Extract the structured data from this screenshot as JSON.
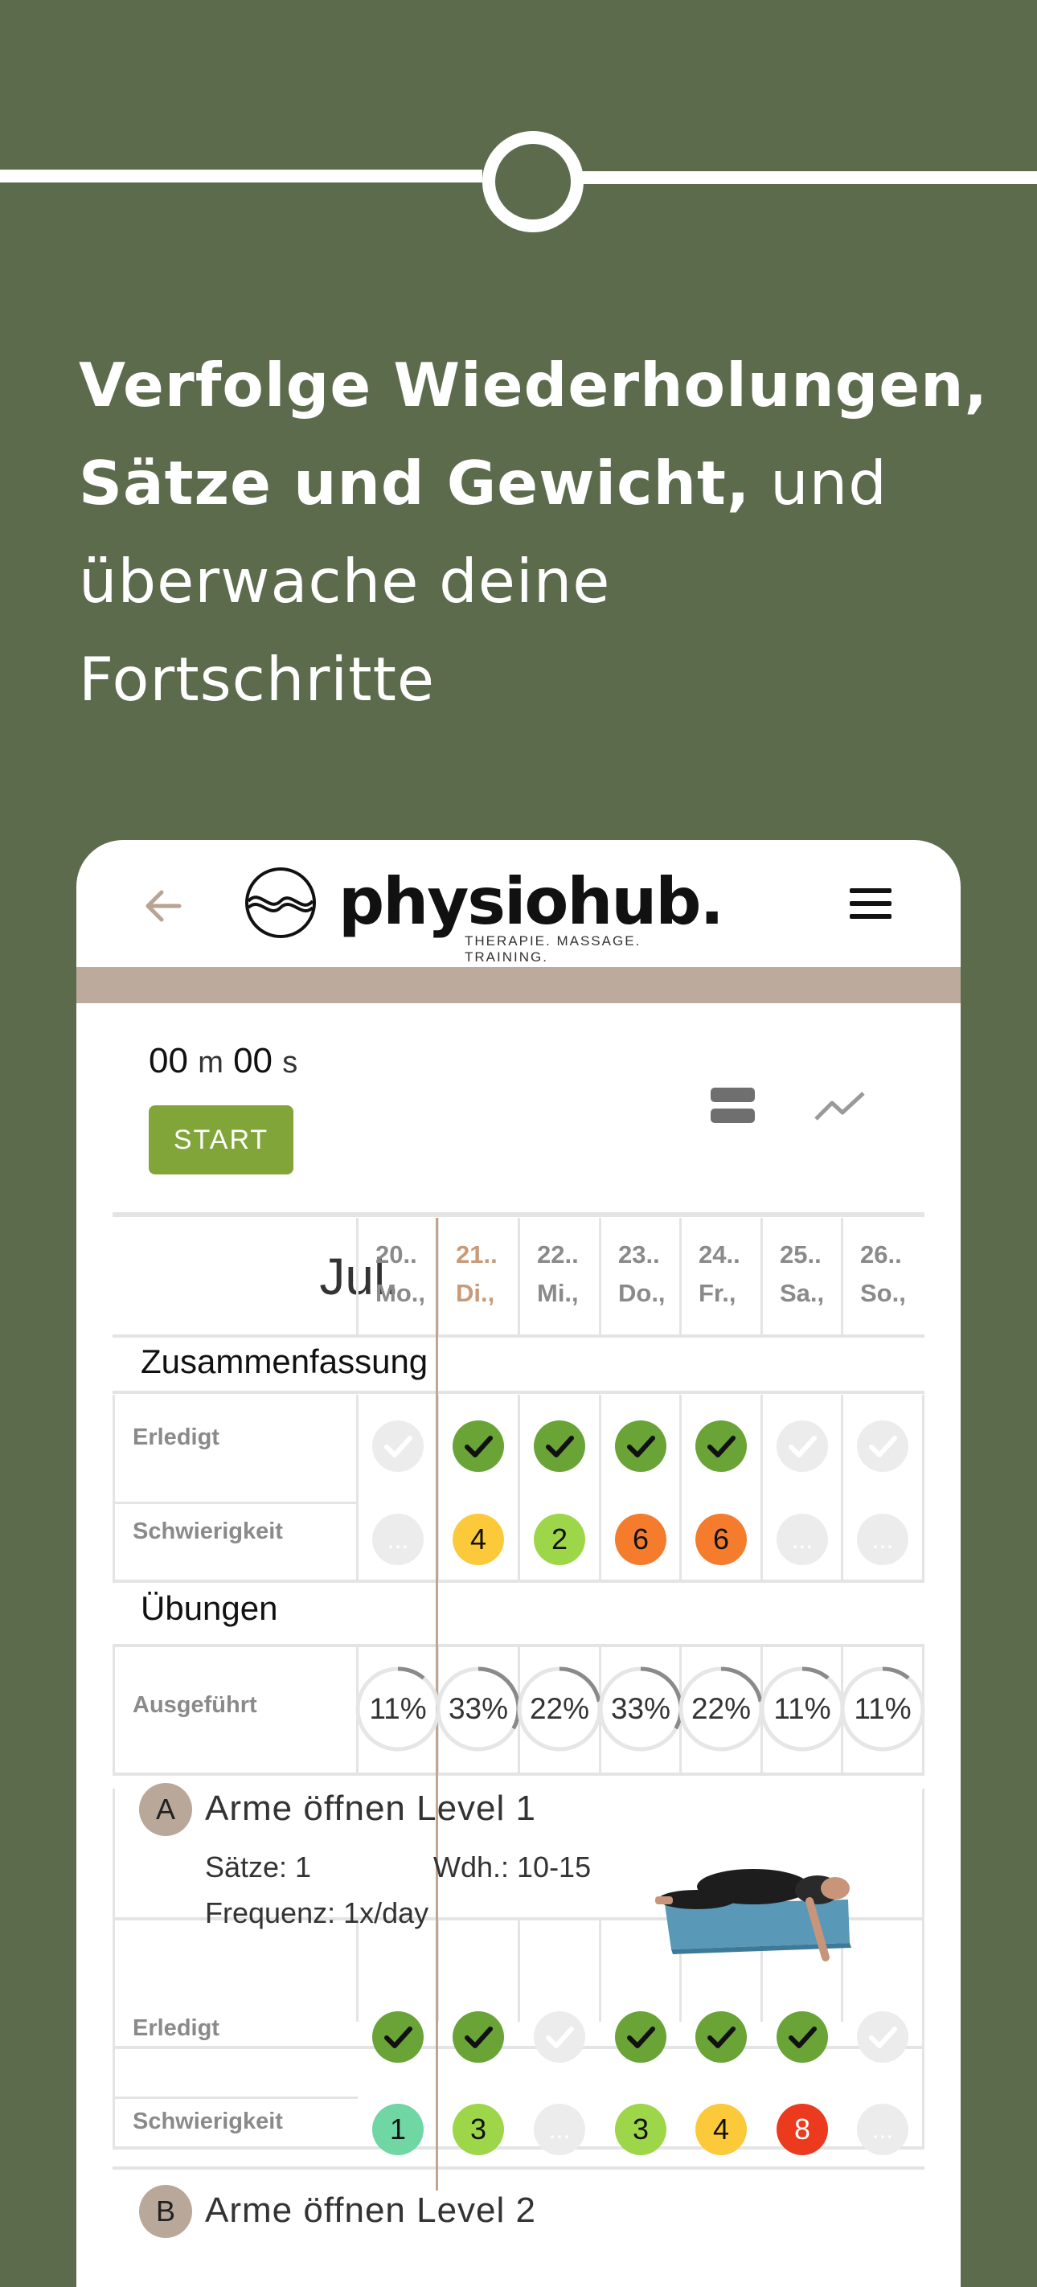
{
  "headline": {
    "bold1": "Verfolge Wiederholungen,",
    "bold2": "Sätze und Gewicht,",
    "normal2": " und",
    "line3": "überwache deine",
    "line4": "Fortschritte"
  },
  "app": {
    "logo_text": "physiohub.",
    "logo_tagline": "THERAPIE. MASSAGE. TRAINING.",
    "colors": {
      "accent": "#82a53a",
      "tan": "#bcaa9c",
      "background": "#5d6b4d"
    }
  },
  "timer": {
    "min": "00",
    "min_unit": "m",
    "sec": "00",
    "sec_unit": "s"
  },
  "start_label": "START",
  "calendar": {
    "month": "Jul.",
    "days": [
      {
        "num": "20..",
        "name": "Mo.,"
      },
      {
        "num": "21..",
        "name": "Di.,"
      },
      {
        "num": "22..",
        "name": "Mi.,"
      },
      {
        "num": "23..",
        "name": "Do.,"
      },
      {
        "num": "24..",
        "name": "Fr.,"
      },
      {
        "num": "25..",
        "name": "Sa.,"
      },
      {
        "num": "26..",
        "name": "So.,"
      }
    ],
    "today_index": 1
  },
  "summary": {
    "title": "Zusammenfassung",
    "done_label": "Erledigt",
    "difficulty_label": "Schwierigkeit",
    "done": [
      false,
      true,
      true,
      true,
      true,
      false,
      false
    ],
    "difficulty": [
      "...",
      "4",
      "2",
      "6",
      "6",
      "...",
      "..."
    ]
  },
  "exercises_section": {
    "title": "Übungen",
    "performed_label": "Ausgeführt",
    "performed": [
      "11%",
      "33%",
      "22%",
      "33%",
      "22%",
      "11%",
      "11%"
    ]
  },
  "exercises": [
    {
      "badge": "A",
      "title": "Arme öffnen Level 1",
      "sets": "Sätze: 1",
      "reps": "Wdh.: 10-15",
      "frequency": "Frequenz: 1x/day",
      "done_label": "Erledigt",
      "difficulty_label": "Schwierigkeit",
      "done": [
        true,
        true,
        false,
        true,
        true,
        true,
        false
      ],
      "difficulty": [
        "1",
        "3",
        "...",
        "3",
        "4",
        "8",
        "..."
      ]
    },
    {
      "badge": "B",
      "title": "Arme öffnen Level 2"
    }
  ]
}
